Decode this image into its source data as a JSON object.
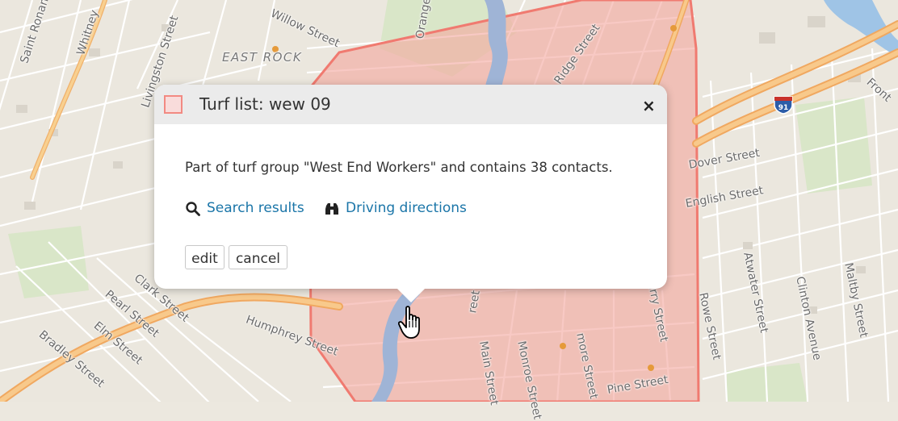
{
  "map": {
    "labels": {
      "area": "EAST ROCK",
      "saint_ronan": "Saint Ronan",
      "whitney": "Whitney",
      "livingston": "Livingston Street",
      "willow": "Willow Street",
      "orange_drive": "Orange Drive",
      "edge_street": "Ridge Street",
      "front": "Front",
      "dover": "Dover Street",
      "english": "English Street",
      "ferry": "Ferry Street",
      "rowe": "Rowe Street",
      "atwater": "Atwater Street",
      "clinton": "Clinton Avenue",
      "maltby": "Maltby Street",
      "pearl": "Pearl Street",
      "clark": "Clark Street",
      "elm": "Elm Street",
      "bradley": "Bradley Street",
      "humphrey": "Humphrey Street",
      "main": "Main Street",
      "monroe": "Monroe Street",
      "more": "more Street",
      "reet": "reet",
      "pine": "Pine Street"
    },
    "highway_shield": "91",
    "colors": {
      "turf_fill": "#f4a8a0",
      "turf_stroke": "#f07a70",
      "river": "#9fb4d6",
      "highway": "#f5b56a",
      "park": "#d5e3c2"
    }
  },
  "popup": {
    "title": "Turf list: wew 09",
    "close_label": "×",
    "description": "Part of turf group \"West End Workers\" and contains 38 contacts.",
    "links": {
      "search": "Search results",
      "directions": "Driving directions"
    },
    "buttons": {
      "edit": "edit",
      "cancel": "cancel"
    },
    "swatch_color": "#f28a82",
    "link_color": "#1a75a8"
  }
}
